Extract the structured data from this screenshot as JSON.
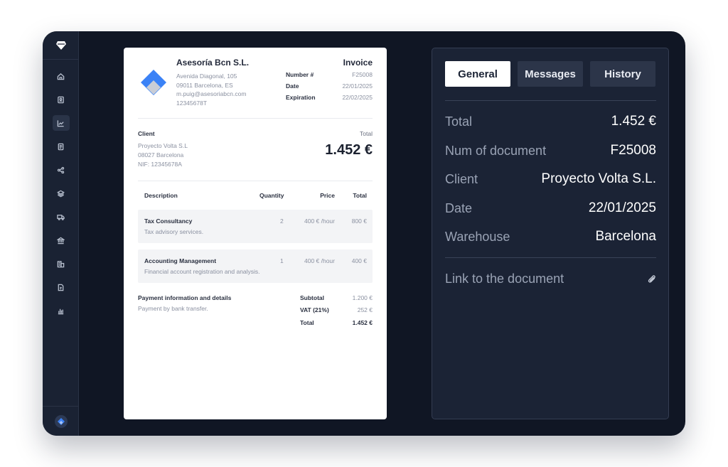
{
  "sidebar": {
    "items": [
      {
        "icon": "home-icon"
      },
      {
        "icon": "contacts-icon"
      },
      {
        "icon": "analytics-icon",
        "active": true
      },
      {
        "icon": "document-icon"
      },
      {
        "icon": "share-icon"
      },
      {
        "icon": "layers-icon"
      },
      {
        "icon": "truck-icon"
      },
      {
        "icon": "bank-icon"
      },
      {
        "icon": "buildings-icon"
      },
      {
        "icon": "file-icon"
      },
      {
        "icon": "bar-chart-icon"
      }
    ]
  },
  "invoice": {
    "company": {
      "name": "Asesoría Bcn S.L.",
      "lines": [
        "Avenida Diagonal, 105",
        "09011 Barcelona, ES",
        "m.puig@asesoriabcn.com",
        "12345678T"
      ]
    },
    "title": "Invoice",
    "meta": [
      {
        "key": "Number #",
        "value": "F25008"
      },
      {
        "key": "Date",
        "value": "22/01/2025"
      },
      {
        "key": "Expiration",
        "value": "22/02/2025"
      }
    ],
    "client_label": "Client",
    "client_lines": [
      "Proyecto Volta S.L",
      "08027 Barcelona",
      "NIF: 12345678A"
    ],
    "total_label": "Total",
    "total_amount": "1.452 €",
    "columns": {
      "description": "Description",
      "quantity": "Quantity",
      "price": "Price",
      "total": "Total"
    },
    "items": [
      {
        "name": "Tax Consultancy",
        "desc": "Tax advisory services.",
        "qty": "2",
        "price": "400 € /hour",
        "total": "800 €"
      },
      {
        "name": "Accounting Management",
        "desc": "Financial account registration and analysis.",
        "qty": "1",
        "price": "400 € /hour",
        "total": "400 €"
      }
    ],
    "payment_title": "Payment information and details",
    "payment_desc": "Payment by bank transfer.",
    "summary": [
      {
        "key": "Subtotal",
        "value": "1.200 €"
      },
      {
        "key": "VAT (21%)",
        "value": "252 €"
      },
      {
        "key": "Total",
        "value": "1.452 €"
      }
    ]
  },
  "panel": {
    "tabs": [
      {
        "label": "General",
        "active": true
      },
      {
        "label": "Messages"
      },
      {
        "label": "History"
      }
    ],
    "rows": [
      {
        "key": "Total",
        "value": "1.452 €"
      },
      {
        "key": "Num of document",
        "value": "F25008"
      },
      {
        "key": "Client",
        "value": "Proyecto Volta S.L."
      },
      {
        "key": "Date",
        "value": "22/01/2025"
      },
      {
        "key": "Warehouse",
        "value": "Barcelona"
      }
    ],
    "link_label": "Link to the document",
    "link_icon": "paperclip-icon"
  },
  "colors": {
    "frame": "#101624",
    "sidebar": "#1a2233",
    "panel": "#1b2335",
    "brand_blue": "#3b82f6"
  }
}
